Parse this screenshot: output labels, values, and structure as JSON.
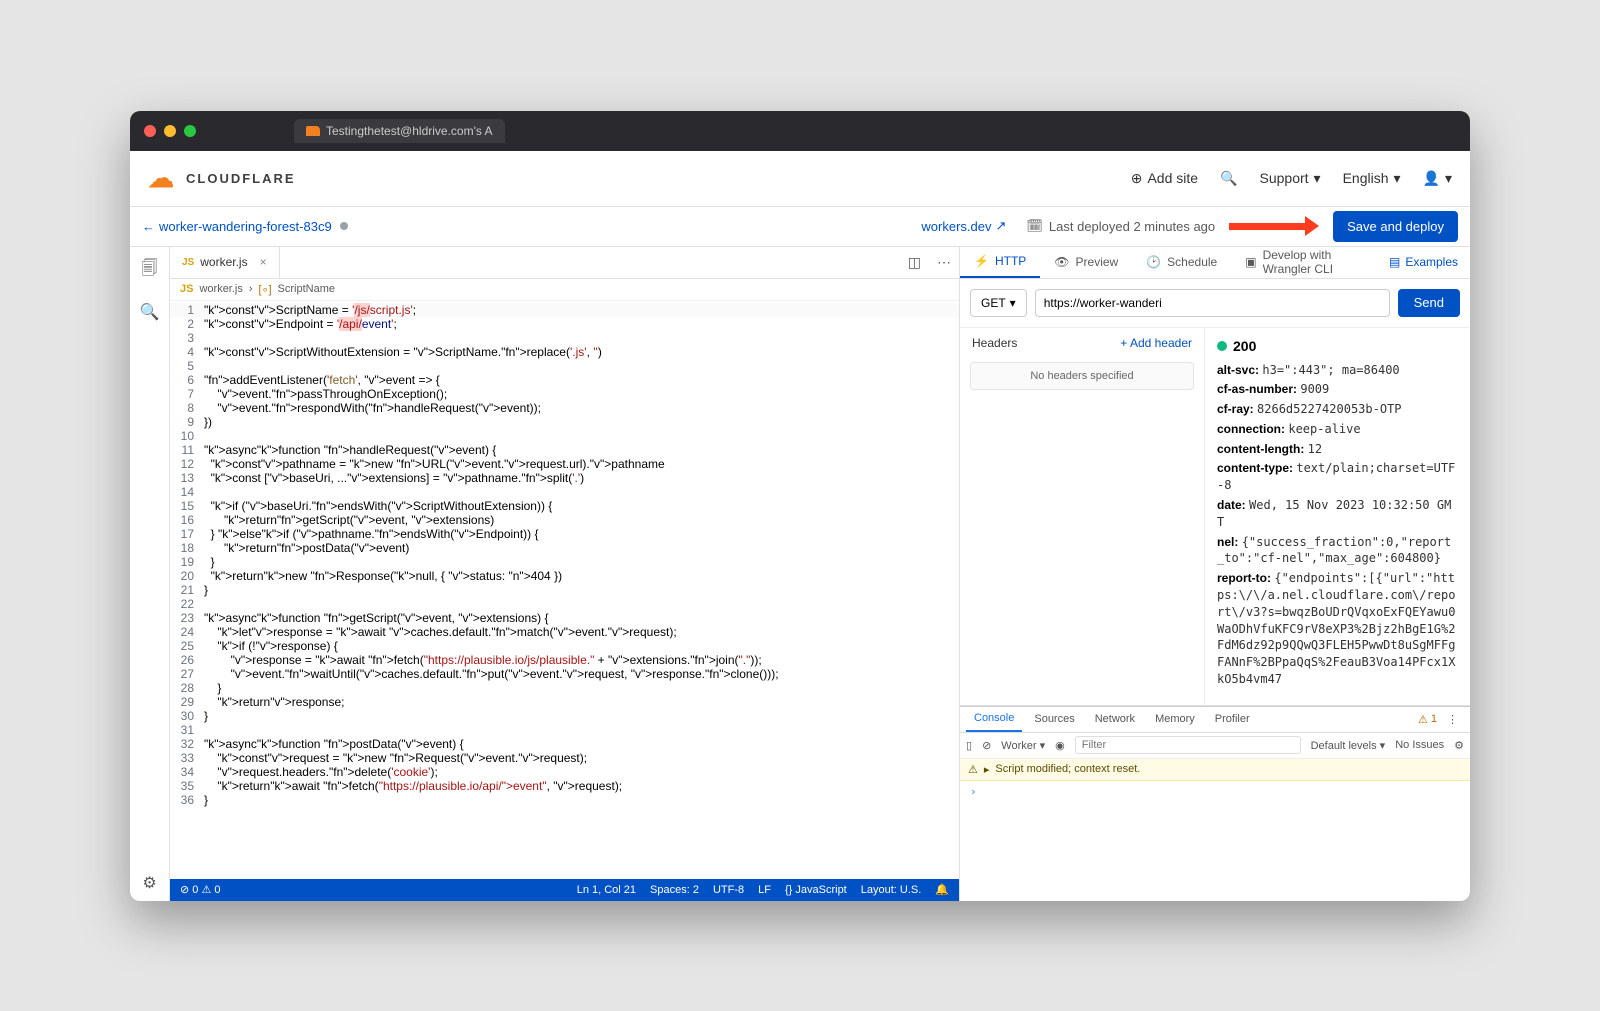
{
  "browser_tab": "Testingthetest@hldrive.com's A",
  "brand": "CLOUDFLARE",
  "header": {
    "add_site": "Add site",
    "support": "Support",
    "language": "English"
  },
  "subheader": {
    "worker_name": "worker-wandering-forest-83c9",
    "workers_dev": "workers.dev",
    "last_deployed": "Last deployed 2 minutes ago",
    "save_deploy": "Save and deploy"
  },
  "editor": {
    "filename": "worker.js",
    "breadcrumb_sym": "ScriptName",
    "lines": [
      "const ScriptName = '/js/script.js';",
      "const Endpoint = '/api/event';",
      "",
      "const ScriptWithoutExtension = ScriptName.replace('.js', '')",
      "",
      "addEventListener('fetch', event => {",
      "    event.passThroughOnException();",
      "    event.respondWith(handleRequest(event));",
      "})",
      "",
      "async function handleRequest(event) {",
      "  const pathname = new URL(event.request.url).pathname",
      "  const [baseUri, ...extensions] = pathname.split('.')",
      "",
      "  if (baseUri.endsWith(ScriptWithoutExtension)) {",
      "      return getScript(event, extensions)",
      "  } else if (pathname.endsWith(Endpoint)) {",
      "      return postData(event)",
      "  }",
      "  return new Response(null, { status: 404 })",
      "}",
      "",
      "async function getScript(event, extensions) {",
      "    let response = await caches.default.match(event.request);",
      "    if (!response) {",
      "        response = await fetch(\"https://plausible.io/js/plausible.\" + extensions.join(\".\"));",
      "        event.waitUntil(caches.default.put(event.request, response.clone()));",
      "    }",
      "    return response;",
      "}",
      "",
      "async function postData(event) {",
      "    const request = new Request(event.request);",
      "    request.headers.delete('cookie');",
      "    return await fetch(\"https://plausible.io/api/event\", request);",
      "}"
    ]
  },
  "statusbar": {
    "errors": "0",
    "warnings": "0",
    "cursor": "Ln 1, Col 21",
    "spaces": "Spaces: 2",
    "encoding": "UTF-8",
    "eol": "LF",
    "lang": "{} JavaScript",
    "layout": "Layout: U.S."
  },
  "http": {
    "tabs": {
      "http": "HTTP",
      "preview": "Preview",
      "schedule": "Schedule",
      "wrangler": "Develop with Wrangler CLI",
      "examples": "Examples"
    },
    "method": "GET",
    "url": "https://worker-wanderi",
    "send": "Send",
    "headers_label": "Headers",
    "add_header": "Add header",
    "no_headers": "No headers specified",
    "status": "200",
    "response_headers": [
      {
        "k": "alt-svc",
        "v": "h3=\":443\"; ma=86400"
      },
      {
        "k": "cf-as-number",
        "v": "9009"
      },
      {
        "k": "cf-ray",
        "v": "8266d5227420053b-OTP"
      },
      {
        "k": "connection",
        "v": "keep-alive"
      },
      {
        "k": "content-length",
        "v": "12"
      },
      {
        "k": "content-type",
        "v": "text/plain;charset=UTF-8"
      },
      {
        "k": "date",
        "v": "Wed, 15 Nov 2023 10:32:50 GMT"
      },
      {
        "k": "nel",
        "v": "{\"success_fraction\":0,\"report_to\":\"cf-nel\",\"max_age\":604800}"
      },
      {
        "k": "report-to",
        "v": "{\"endpoints\":[{\"url\":\"https:\\/\\/a.nel.cloudflare.com\\/report\\/v3?s=bwqzBoUDrQVqxoExFQEYawu0WaODhVfuKFC9rV8eXP3%2Bjz2hBgE1G%2FdM6dz92p9QQwQ3FLEH5PwwDt8uSgMFFgFANnF%2BPpaQqS%2FeauB3Voa14PFcx1XkO5b4vm47"
      }
    ]
  },
  "devtools": {
    "tabs": [
      "Console",
      "Sources",
      "Network",
      "Memory",
      "Profiler"
    ],
    "warn_count": "1",
    "context": "Worker",
    "filter_ph": "Filter",
    "levels": "Default levels",
    "no_issues": "No Issues",
    "log": "Script modified; context reset."
  }
}
